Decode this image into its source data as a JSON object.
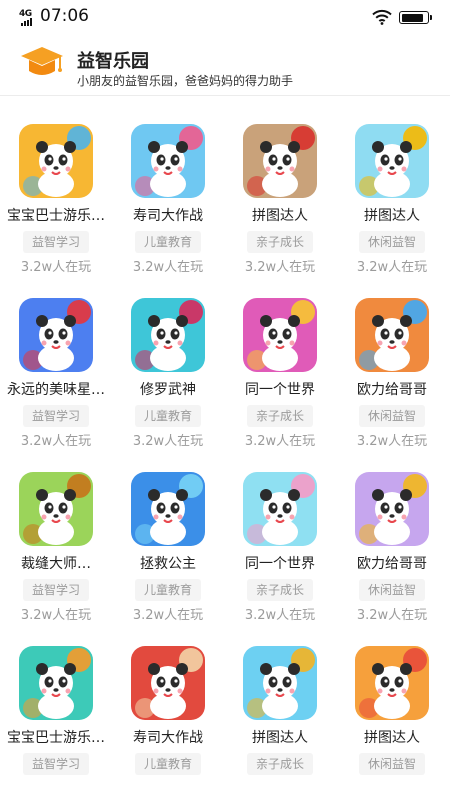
{
  "status_bar": {
    "network": "4G",
    "time": "07:06",
    "battery_level": 0.9,
    "icons": [
      "signal-icon",
      "wifi-icon",
      "battery-icon"
    ]
  },
  "header": {
    "logo_icon": "graduation-cap-icon",
    "title": "益智乐园",
    "subtitle": "小朋友的益智乐园，爸爸妈妈的得力助手"
  },
  "colors": {
    "logo_orange": "#f5a023",
    "tag_background": "#f4f4f4",
    "secondary_text": "#9b9b9b"
  },
  "games": [
    {
      "name": "宝宝巴士游乐…",
      "tag": "益智学习",
      "players": "3.2w人在玩",
      "icon": "panda-airplane-icon",
      "bg": "#f7b733",
      "accent": "#4fb4e8"
    },
    {
      "name": "寿司大作战",
      "tag": "儿童教育",
      "players": "3.2w人在玩",
      "icon": "panda-cotton-candy-icon",
      "bg": "#6fc8f2",
      "accent": "#f05b8d"
    },
    {
      "name": "拼图达人",
      "tag": "亲子成长",
      "players": "3.2w人在玩",
      "icon": "panda-firefighter-icon",
      "bg": "#c9a27a",
      "accent": "#d8322c"
    },
    {
      "name": "拼图达人",
      "tag": "休闲益智",
      "players": "3.2w人在玩",
      "icon": "panda-candy-icon",
      "bg": "#8fdcf2",
      "accent": "#f6b800"
    },
    {
      "name": "永远的美味星…",
      "tag": "益智学习",
      "players": "3.2w人在玩",
      "icon": "panda-fruits-icon",
      "bg": "#4d7ff0",
      "accent": "#e8353a"
    },
    {
      "name": "修罗武神",
      "tag": "儿童教育",
      "players": "3.2w人在玩",
      "icon": "panda-fruit-slice-icon",
      "bg": "#3ec6d8",
      "accent": "#d8285c"
    },
    {
      "name": "同一个世界",
      "tag": "亲子成长",
      "players": "3.2w人在玩",
      "icon": "panda-party-icon",
      "bg": "#e05bb8",
      "accent": "#f7c531"
    },
    {
      "name": "欧力给哥哥",
      "tag": "休闲益智",
      "players": "3.2w人在玩",
      "icon": "panda-water-icon",
      "bg": "#f08a3e",
      "accent": "#3fa9f5"
    },
    {
      "name": "裁缝大师…",
      "tag": "益智学习",
      "players": "3.2w人在玩",
      "icon": "panda-farmer-icon",
      "bg": "#9bd45a",
      "accent": "#c7741a"
    },
    {
      "name": "拯救公主",
      "tag": "儿童教育",
      "players": "3.2w人在玩",
      "icon": "panda-doctor-icon",
      "bg": "#3b8fe8",
      "accent": "#78d3f5"
    },
    {
      "name": "同一个世界",
      "tag": "亲子成长",
      "players": "3.2w人在玩",
      "icon": "panda-bath-icon",
      "bg": "#8fe0f2",
      "accent": "#f59bc6"
    },
    {
      "name": "欧力给哥哥",
      "tag": "休闲益智",
      "players": "3.2w人在玩",
      "icon": "panda-toilet-icon",
      "bg": "#c6a6ee",
      "accent": "#f2b81c"
    },
    {
      "name": "宝宝巴士游乐…",
      "tag": "益智学习",
      "players": "",
      "icon": "fox-comb-icon",
      "bg": "#3dcab8",
      "accent": "#f59a2a"
    },
    {
      "name": "寿司大作战",
      "tag": "儿童教育",
      "players": "",
      "icon": "panda-teacup-icon",
      "bg": "#e24a3e",
      "accent": "#f3d3a6"
    },
    {
      "name": "拼图达人",
      "tag": "亲子成长",
      "players": "",
      "icon": "panda-honey-icon",
      "bg": "#6dd0f2",
      "accent": "#f3b222"
    },
    {
      "name": "拼图达人",
      "tag": "休闲益智",
      "players": "",
      "icon": "monkey-noodles-icon",
      "bg": "#f6a03c",
      "accent": "#e84b3a"
    }
  ]
}
